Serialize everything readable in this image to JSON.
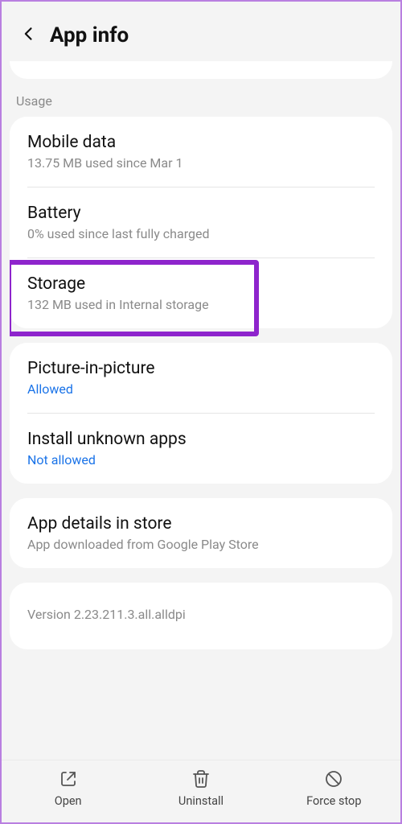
{
  "header": {
    "title": "App info"
  },
  "sections": {
    "usage_label": "Usage"
  },
  "items": {
    "mobile_data": {
      "title": "Mobile data",
      "sub": "13.75 MB used since Mar 1"
    },
    "battery": {
      "title": "Battery",
      "sub": "0% used since last fully charged"
    },
    "storage": {
      "title": "Storage",
      "sub": "132 MB used in Internal storage"
    },
    "pip": {
      "title": "Picture-in-picture",
      "sub": "Allowed"
    },
    "unknown": {
      "title": "Install unknown apps",
      "sub": "Not allowed"
    },
    "details": {
      "title": "App details in store",
      "sub": "App downloaded from Google Play Store"
    }
  },
  "version": "Version 2.23.211.3.all.alldpi",
  "bottom": {
    "open": "Open",
    "uninstall": "Uninstall",
    "force_stop": "Force stop"
  }
}
